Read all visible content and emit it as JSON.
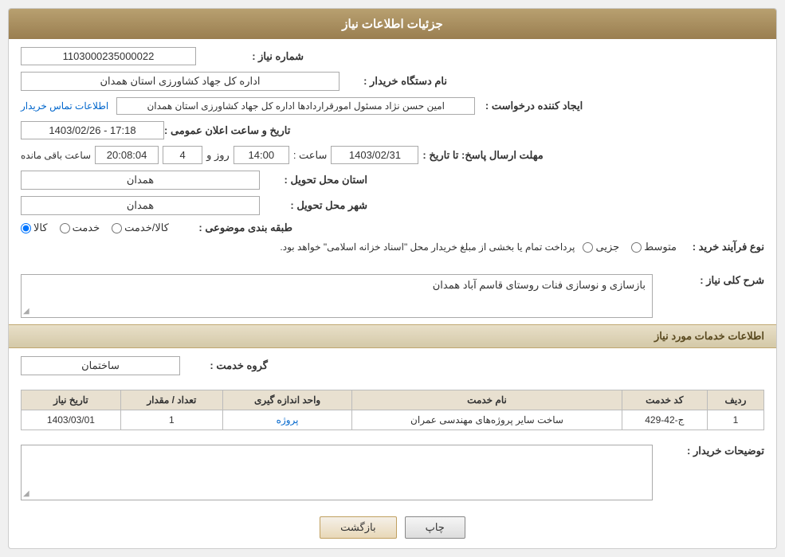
{
  "header": {
    "title": "جزئیات اطلاعات نیاز"
  },
  "sections": {
    "need_info": "جزئیات اطلاعات نیاز",
    "service_info": "اطلاعات خدمات مورد نیاز"
  },
  "fields": {
    "need_number_label": "شماره نیاز :",
    "need_number_value": "1103000235000022",
    "buyer_org_label": "نام دستگاه خریدار :",
    "buyer_org_value": "اداره کل جهاد کشاورزی استان همدان",
    "requester_label": "ایجاد کننده درخواست :",
    "requester_value": "امین حسن نژاد مسئول امورقراردادها اداره کل جهاد کشاورزی استان همدان",
    "contact_link": "اطلاعات تماس خریدار",
    "deadline_label": "مهلت ارسال پاسخ: تا تاریخ :",
    "deadline_date": "1403/02/31",
    "deadline_time_label": "ساعت :",
    "deadline_time": "14:00",
    "deadline_days_label": "روز و",
    "deadline_days": "4",
    "deadline_remaining_label": "ساعت باقی مانده",
    "deadline_remaining": "20:08:04",
    "announcement_label": "تاریخ و ساعت اعلان عمومی :",
    "announcement_value": "1403/02/26 - 17:18",
    "province_label": "استان محل تحویل :",
    "province_value": "همدان",
    "city_label": "شهر محل تحویل :",
    "city_value": "همدان",
    "category_label": "طبقه بندی موضوعی :",
    "category_kala": "کالا",
    "category_khadamat": "خدمت",
    "category_kala_khadamat": "کالا/خدمت",
    "purchase_type_label": "نوع فرآیند خرید :",
    "purchase_type_jozvi": "جزیی",
    "purchase_type_mottavaset": "متوسط",
    "purchase_type_note": "پرداخت تمام یا بخشی از مبلغ خریدار محل \"اسناد خزانه اسلامی\" خواهد بود."
  },
  "description": {
    "label": "شرح کلی نیاز :",
    "value": "بازسازی و نوسازی فنات روستای قاسم آباد همدان"
  },
  "service_group": {
    "label": "گروه خدمت :",
    "value": "ساختمان"
  },
  "table": {
    "columns": [
      "ردیف",
      "کد خدمت",
      "نام خدمت",
      "واحد اندازه گیری",
      "تعداد / مقدار",
      "تاریخ نیاز"
    ],
    "rows": [
      {
        "row": "1",
        "service_code": "ج-42-429",
        "service_name": "ساخت سایر پروژه‌های مهندسی عمران",
        "unit": "پروژه",
        "quantity": "1",
        "date": "1403/03/01"
      }
    ]
  },
  "buyer_comment": {
    "label": "توضیحات خریدار :"
  },
  "buttons": {
    "print": "چاپ",
    "back": "بازگشت"
  },
  "icons": {
    "resize": "◢"
  }
}
